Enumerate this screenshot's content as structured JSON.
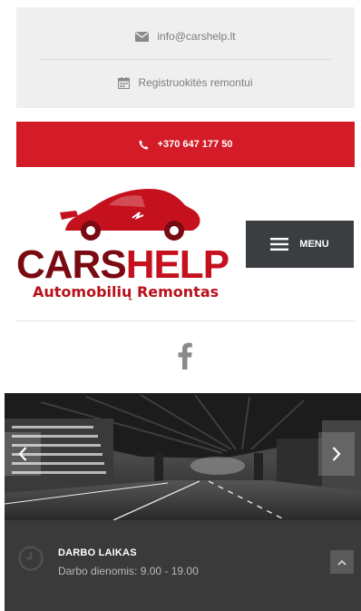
{
  "contact": {
    "email": "info@carshelp.lt",
    "email_icon": "envelope-icon",
    "repair_label": "Registruokitės remontui",
    "repair_icon": "calendar-icon"
  },
  "phone": {
    "number": "+370 647 177 50",
    "icon": "phone-icon",
    "color": "#d41c28"
  },
  "logo": {
    "word_cars": "CARS",
    "word_help": "HELP",
    "subtitle": "Automobilių Remontas"
  },
  "menu": {
    "label": "MENU",
    "icon": "hamburger-icon"
  },
  "social": {
    "icon": "facebook-icon"
  },
  "slider": {
    "prev_icon": "chevron-left-icon",
    "next_icon": "chevron-right-icon"
  },
  "hours": {
    "title": "DARBO LAIKAS",
    "text": "Darbo dienomis: 9.00 - 19.00",
    "icon": "clock-icon",
    "scroll_icon": "chevron-up-icon"
  }
}
